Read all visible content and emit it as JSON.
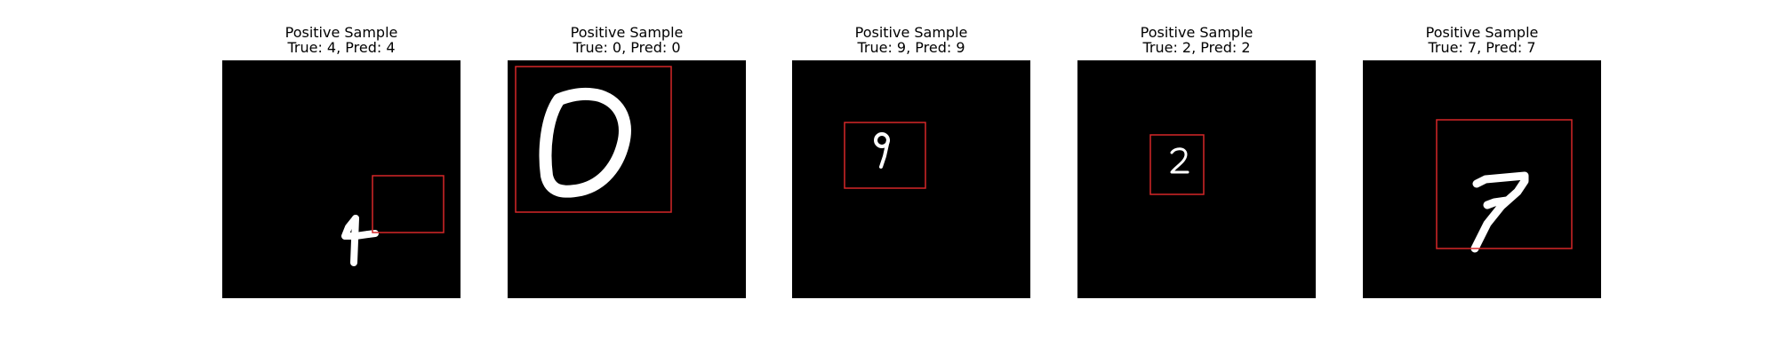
{
  "figure": {
    "samples": [
      {
        "title": "Positive Sample",
        "subtitle": "True: 4, Pred: 4",
        "digit": "4",
        "box_color": "#d62728"
      },
      {
        "title": "Positive Sample",
        "subtitle": "True: 0, Pred: 0",
        "digit": "0",
        "box_color": "#d62728"
      },
      {
        "title": "Positive Sample",
        "subtitle": "True: 9, Pred: 9",
        "digit": "9",
        "box_color": "#d62728"
      },
      {
        "title": "Positive Sample",
        "subtitle": "True: 2, Pred: 2",
        "digit": "2",
        "box_color": "#d62728"
      },
      {
        "title": "Positive Sample",
        "subtitle": "True: 7, Pred: 7",
        "digit": "7",
        "box_color": "#d62728"
      }
    ]
  }
}
